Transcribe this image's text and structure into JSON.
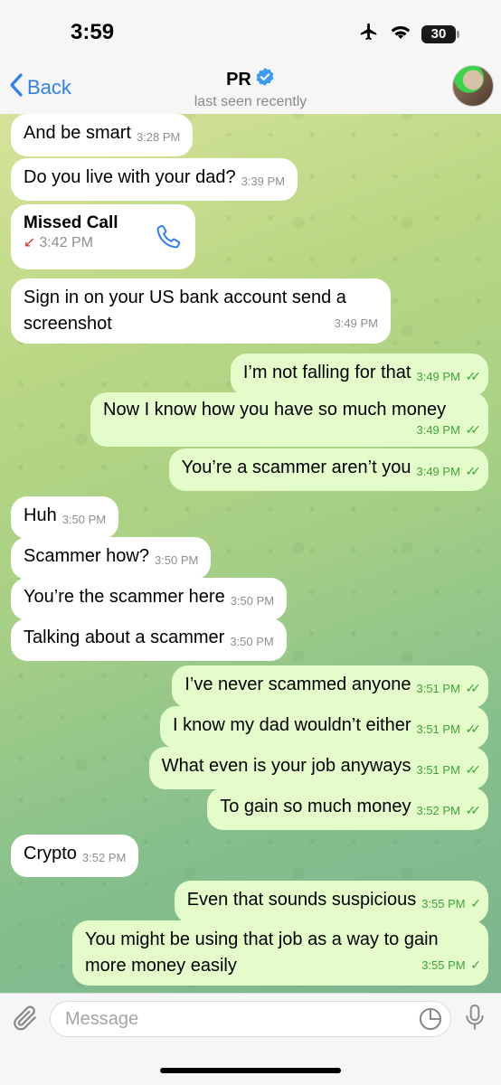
{
  "status_bar": {
    "time": "3:59",
    "battery": "30"
  },
  "header": {
    "back_label": "Back",
    "contact_name": "PR",
    "status": "last seen recently"
  },
  "messages": [
    {
      "side": "in",
      "text": "And be smart",
      "time": "3:28 PM"
    },
    {
      "side": "in",
      "text": "Do you live with your dad?",
      "time": "3:39 PM"
    },
    {
      "side": "in",
      "type": "missed-call",
      "title": "Missed Call",
      "time": "3:42 PM"
    },
    {
      "side": "in",
      "text": "Sign in on your US bank account send a screenshot",
      "time": "3:49 PM"
    },
    {
      "side": "out",
      "text": "I’m not falling for that",
      "time": "3:49 PM",
      "read": true
    },
    {
      "side": "out",
      "text": "Now I know how you have so much money",
      "time": "3:49 PM",
      "read": true
    },
    {
      "side": "out",
      "text": "You’re a scammer aren’t you",
      "time": "3:49 PM",
      "read": true
    },
    {
      "side": "in",
      "text": "Huh",
      "time": "3:50 PM"
    },
    {
      "side": "in",
      "text": "Scammer how?",
      "time": "3:50 PM"
    },
    {
      "side": "in",
      "text": "You’re the scammer here",
      "time": "3:50 PM"
    },
    {
      "side": "in",
      "text": "Talking about a scammer",
      "time": "3:50 PM"
    },
    {
      "side": "out",
      "text": "I’ve never scammed anyone",
      "time": "3:51 PM",
      "read": true
    },
    {
      "side": "out",
      "text": "I know my dad wouldn’t either",
      "time": "3:51 PM",
      "read": true
    },
    {
      "side": "out",
      "text": "What even is your job anyways",
      "time": "3:51 PM",
      "read": true
    },
    {
      "side": "out",
      "text": "To gain so much money",
      "time": "3:52 PM",
      "read": true
    },
    {
      "side": "in",
      "text": "Crypto",
      "time": "3:52 PM"
    },
    {
      "side": "out",
      "text": "Even that sounds suspicious",
      "time": "3:55 PM",
      "read": false
    },
    {
      "side": "out",
      "text": "You might be using that job as a way to gain more money easily",
      "time": "3:55 PM",
      "read": false
    }
  ],
  "input": {
    "placeholder": "Message"
  },
  "colors": {
    "accent": "#2f80ed",
    "incoming_bubble": "#ffffff",
    "outgoing_bubble": "#e4fcc9",
    "outgoing_meta": "#3fa23a",
    "missed_arrow": "#e0302a"
  },
  "icons": [
    "airplane-icon",
    "wifi-icon",
    "battery-icon",
    "chevron-left-icon",
    "verified-badge-icon",
    "phone-icon",
    "paperclip-icon",
    "sticker-icon",
    "microphone-icon"
  ]
}
